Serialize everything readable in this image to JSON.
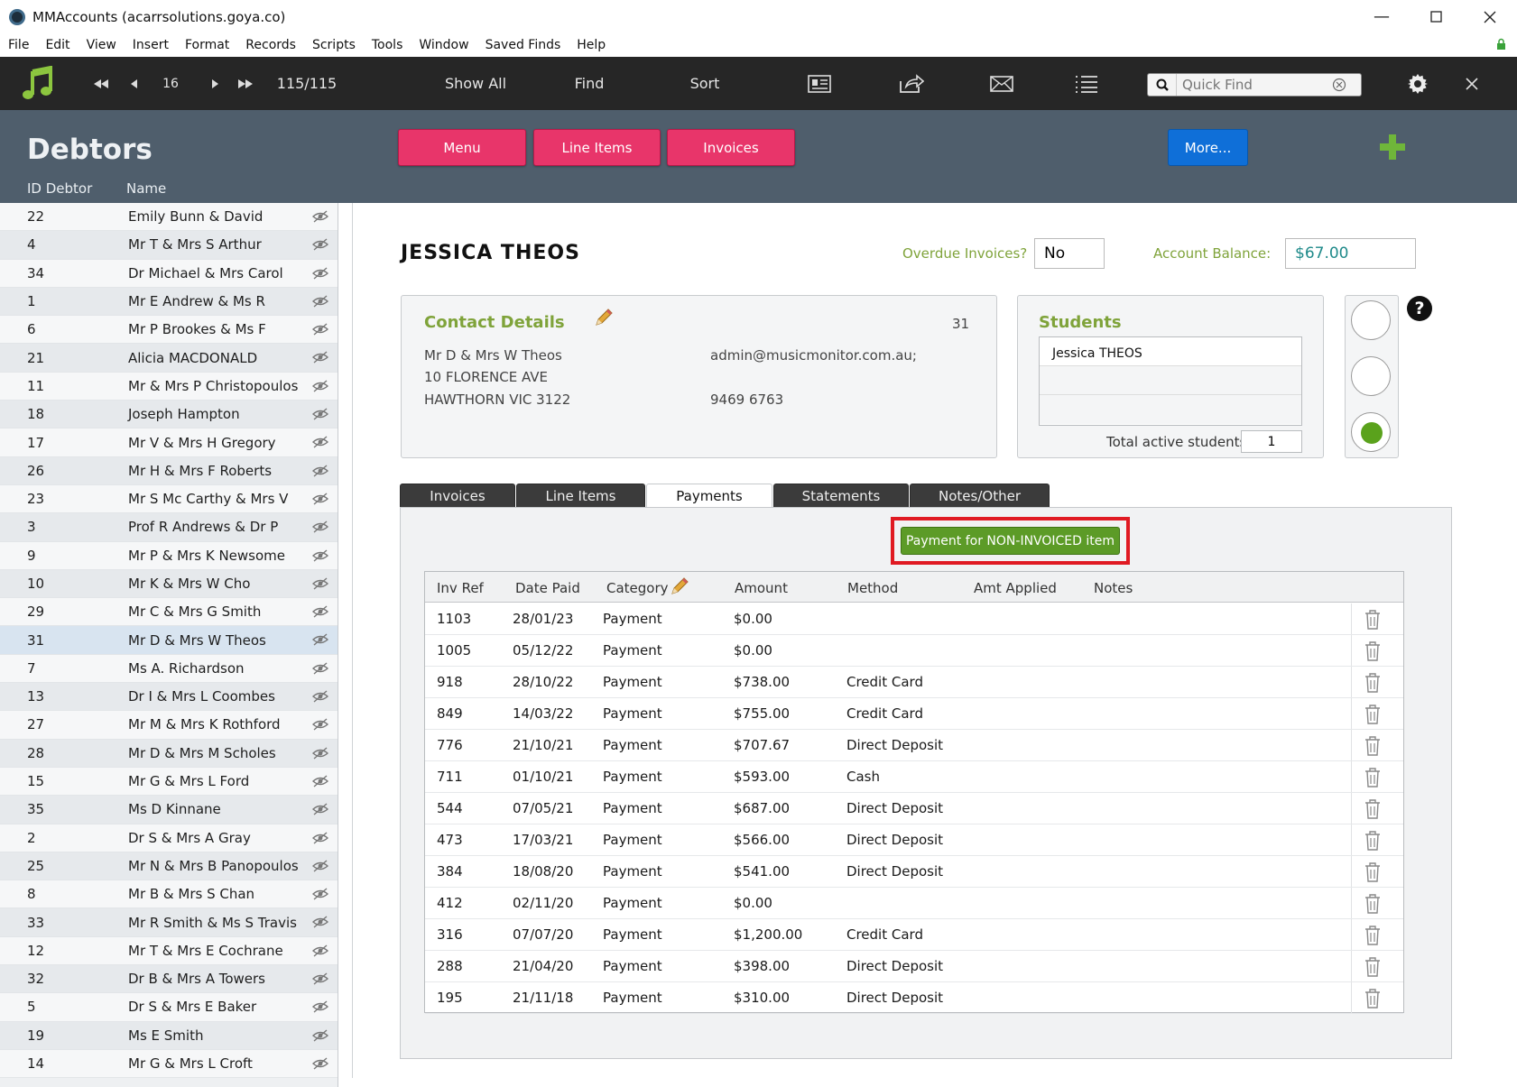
{
  "window": {
    "title": "MMAccounts (acarrsolutions.goya.co)"
  },
  "menu": [
    "File",
    "Edit",
    "View",
    "Insert",
    "Format",
    "Records",
    "Scripts",
    "Tools",
    "Window",
    "Saved Finds",
    "Help"
  ],
  "toolbar": {
    "record_number": "16",
    "record_count": "115/115",
    "show_all": "Show All",
    "find": "Find",
    "sort": "Sort",
    "quickfind_placeholder": "Quick Find"
  },
  "header": {
    "title": "Debtors",
    "col_id": "ID Debtor",
    "col_name": "Name",
    "btn_menu": "Menu",
    "btn_line_items": "Line Items",
    "btn_invoices": "Invoices",
    "btn_more": "More..."
  },
  "debtors": [
    {
      "id": "22",
      "name": "Emily Bunn & David"
    },
    {
      "id": "4",
      "name": "Mr T & Mrs S Arthur"
    },
    {
      "id": "34",
      "name": "Dr Michael & Mrs Carol"
    },
    {
      "id": "1",
      "name": "Mr E Andrew & Ms R"
    },
    {
      "id": "6",
      "name": "Mr P Brookes & Ms F"
    },
    {
      "id": "21",
      "name": "Alicia MACDONALD"
    },
    {
      "id": "11",
      "name": "Mr & Mrs P Christopoulos"
    },
    {
      "id": "18",
      "name": "Joseph Hampton"
    },
    {
      "id": "17",
      "name": "Mr V & Mrs H Gregory"
    },
    {
      "id": "26",
      "name": "Mr H & Mrs F Roberts"
    },
    {
      "id": "23",
      "name": "Mr S Mc Carthy & Mrs V"
    },
    {
      "id": "3",
      "name": "Prof R Andrews & Dr P"
    },
    {
      "id": "9",
      "name": "Mr P & Mrs K Newsome"
    },
    {
      "id": "10",
      "name": "Mr K & Mrs W Cho"
    },
    {
      "id": "29",
      "name": "Mr C & Mrs G Smith"
    },
    {
      "id": "31",
      "name": "Mr D & Mrs W Theos"
    },
    {
      "id": "7",
      "name": "Ms A. Richardson"
    },
    {
      "id": "13",
      "name": "Dr I & Mrs L Coombes"
    },
    {
      "id": "27",
      "name": "Mr M & Mrs K Rothford"
    },
    {
      "id": "28",
      "name": "Mr D & Mrs M Scholes"
    },
    {
      "id": "15",
      "name": "Mr G & Mrs L Ford"
    },
    {
      "id": "35",
      "name": "Ms D Kinnane"
    },
    {
      "id": "2",
      "name": "Dr S & Mrs A Gray"
    },
    {
      "id": "25",
      "name": "Mr N & Mrs B Panopoulos"
    },
    {
      "id": "8",
      "name": "Mr B & Mrs S Chan"
    },
    {
      "id": "33",
      "name": "Mr R Smith & Ms S Travis"
    },
    {
      "id": "12",
      "name": "Mr T & Mrs E Cochrane"
    },
    {
      "id": "32",
      "name": "Dr B & Mrs A Towers"
    },
    {
      "id": "5",
      "name": "Dr S & Mrs E Baker"
    },
    {
      "id": "19",
      "name": "Ms E Smith"
    },
    {
      "id": "14",
      "name": "Mr G & Mrs L Croft"
    }
  ],
  "selected_debtor_id": "31",
  "record": {
    "name": "JESSICA THEOS",
    "overdue_label": "Overdue Invoices?",
    "overdue_value": "No",
    "balance_label": "Account Balance:",
    "balance_value": "$67.00"
  },
  "contact": {
    "title": "Contact Details",
    "id": "31",
    "line1": "Mr D & Mrs W Theos",
    "line2": "10 FLORENCE AVE",
    "line3": "HAWTHORN VIC 3122",
    "email": "admin@musicmonitor.com.au;",
    "phone": "9469 6763"
  },
  "students": {
    "title": "Students",
    "list": [
      "Jessica THEOS",
      "",
      ""
    ],
    "total_label": "Total active students",
    "total_value": "1"
  },
  "tabs": [
    "Invoices",
    "Line Items",
    "Payments",
    "Statements",
    "Notes/Other"
  ],
  "active_tab": "Payments",
  "payments": {
    "button": "Payment for NON-INVOICED item",
    "columns": [
      "Inv Ref",
      "Date Paid",
      "Category",
      "Amount",
      "Method",
      "Amt Applied",
      "Notes"
    ],
    "rows": [
      {
        "ref": "1103",
        "date": "28/01/23",
        "category": "Payment",
        "amount": "$0.00",
        "method": ""
      },
      {
        "ref": "1005",
        "date": "05/12/22",
        "category": "Payment",
        "amount": "$0.00",
        "method": ""
      },
      {
        "ref": "918",
        "date": "28/10/22",
        "category": "Payment",
        "amount": "$738.00",
        "method": "Credit Card"
      },
      {
        "ref": "849",
        "date": "14/03/22",
        "category": "Payment",
        "amount": "$755.00",
        "method": "Credit Card"
      },
      {
        "ref": "776",
        "date": "21/10/21",
        "category": "Payment",
        "amount": "$707.67",
        "method": "Direct Deposit"
      },
      {
        "ref": "711",
        "date": "01/10/21",
        "category": "Payment",
        "amount": "$593.00",
        "method": "Cash"
      },
      {
        "ref": "544",
        "date": "07/05/21",
        "category": "Payment",
        "amount": "$687.00",
        "method": "Direct Deposit"
      },
      {
        "ref": "473",
        "date": "17/03/21",
        "category": "Payment",
        "amount": "$566.00",
        "method": "Direct Deposit"
      },
      {
        "ref": "384",
        "date": "18/08/20",
        "category": "Payment",
        "amount": "$541.00",
        "method": "Direct Deposit"
      },
      {
        "ref": "412",
        "date": "02/11/20",
        "category": "Payment",
        "amount": "$0.00",
        "method": ""
      },
      {
        "ref": "316",
        "date": "07/07/20",
        "category": "Payment",
        "amount": "$1,200.00",
        "method": "Credit Card"
      },
      {
        "ref": "288",
        "date": "21/04/20",
        "category": "Payment",
        "amount": "$398.00",
        "method": "Direct Deposit"
      },
      {
        "ref": "195",
        "date": "21/11/18",
        "category": "Payment",
        "amount": "$310.00",
        "method": "Direct Deposit"
      }
    ]
  },
  "colors": {
    "accent_pink": "#e8356a",
    "accent_blue": "#0f6fd8",
    "accent_green": "#5c9b27",
    "label_green": "#7fa33a",
    "highlight_red": "#e01a22"
  }
}
